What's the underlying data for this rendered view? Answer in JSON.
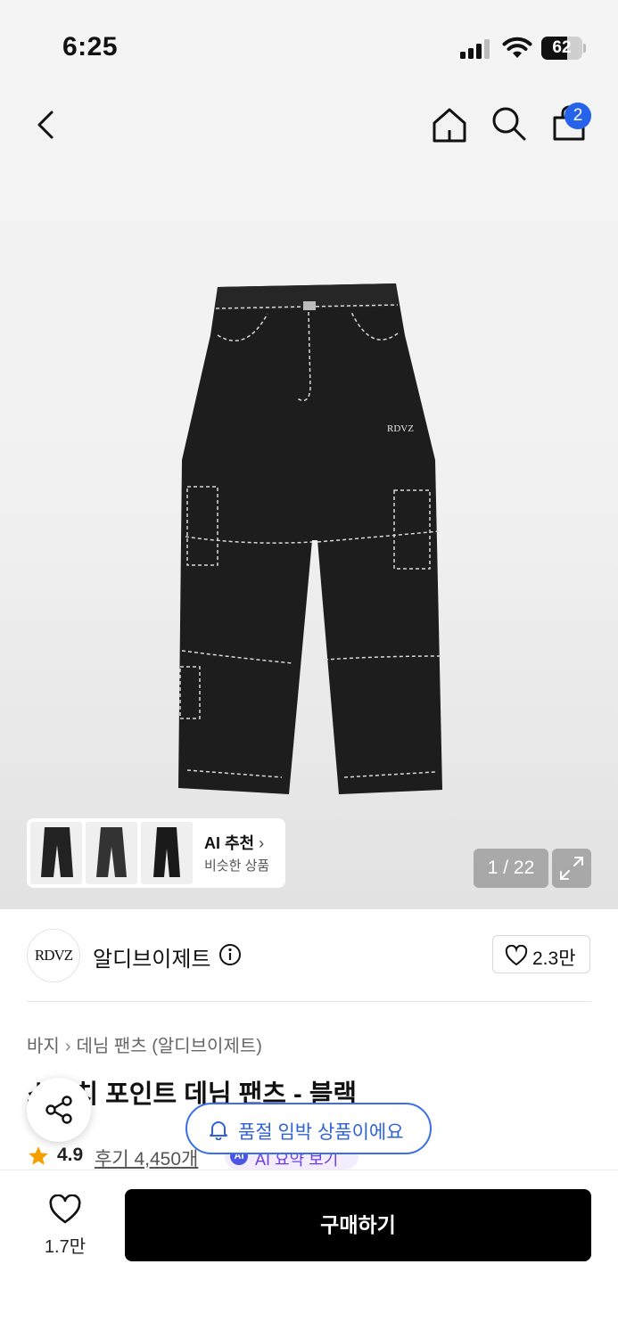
{
  "status_bar": {
    "time": "6:25",
    "battery_percent": "62",
    "battery_level": 0.62
  },
  "nav": {
    "cart_count": "2"
  },
  "ai_recommend": {
    "title": "AI 추천",
    "subtitle": "비슷한 상품"
  },
  "gallery": {
    "counter": "1 / 22"
  },
  "brand": {
    "logo_text": "RDVZ",
    "name": "알디브이제트",
    "like_count": "2.3만"
  },
  "breadcrumb": [
    "바지",
    "데님 팬츠 (알디브이제트)"
  ],
  "product": {
    "title": "스티치 포인트 데님 팬츠 - 블랙",
    "rating": "4.9",
    "reviews": "후기 4,450개",
    "ai_summary": "AI 요약 보기"
  },
  "notice": {
    "soldout_text": "품절 임박 상품이에요"
  },
  "bottom": {
    "wish_count": "1.7만",
    "buy_label": "구매하기"
  },
  "colors": {
    "accent_blue": "#2f62d9",
    "badge_blue": "#2563eb",
    "star": "#f5a000",
    "buy_button": "#000000"
  }
}
